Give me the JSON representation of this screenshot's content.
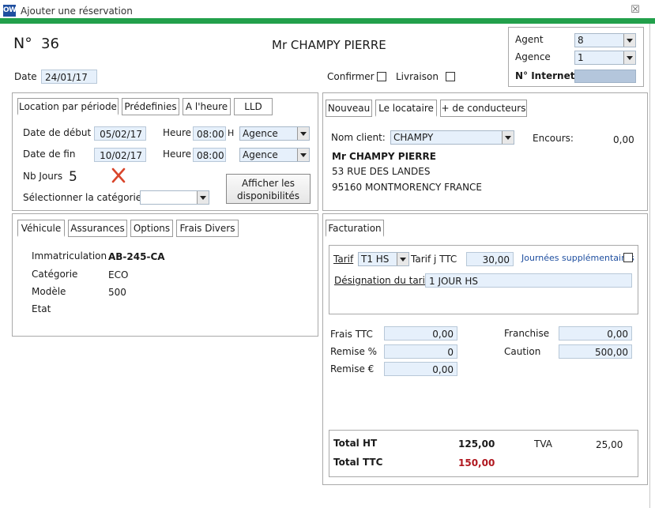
{
  "window": {
    "icon_text": "OW",
    "title": "Ajouter une réservation",
    "close_symbol": "☒"
  },
  "header": {
    "no_label": "N°",
    "no_value": "36",
    "client_title": "Mr CHAMPY PIERRE",
    "date_label": "Date",
    "date_value": "24/01/17",
    "confirmer_label": "Confirmer",
    "livraison_label": "Livraison",
    "agent_label": "Agent",
    "agent_value": "8",
    "agence_label": "Agence",
    "agence_value": "1",
    "internet_label": "N° Internet",
    "internet_value": ""
  },
  "rental": {
    "tabs": [
      "Location par période",
      "Prédefinies",
      "A l'heure",
      "LLD"
    ],
    "start_label": "Date de début",
    "start_date": "05/02/17",
    "heure_label": "Heure",
    "start_time": "08:00",
    "h_suffix": "H",
    "start_place": "Agence",
    "end_label": "Date de fin",
    "end_date": "10/02/17",
    "end_time": "08:00",
    "end_place": "Agence",
    "days_label": "Nb Jours",
    "days_value": "5",
    "category_label": "Sélectionner la catégorie",
    "category_value": "",
    "dispo_button_line1": "Afficher les",
    "dispo_button_line2": "disponibilités"
  },
  "renter": {
    "tabs": [
      "Nouveau",
      "Le locataire",
      "+ de conducteurs"
    ],
    "client_label": "Nom client:",
    "client_value": "CHAMPY",
    "encours_label": "Encours:",
    "encours_value": "0,00",
    "name": "Mr CHAMPY PIERRE",
    "address1": "53 RUE DES LANDES",
    "address2": "95160 MONTMORENCY FRANCE"
  },
  "vehicle": {
    "tabs": [
      "Véhicule",
      "Assurances",
      "Options",
      "Frais Divers"
    ],
    "immat_label": "Immatriculation",
    "immat_value": "AB-245-CA",
    "cat_label": "Catégorie",
    "cat_value": "ECO",
    "model_label": "Modèle",
    "model_value": "500",
    "etat_label": "Etat",
    "etat_value": ""
  },
  "billing": {
    "tab": "Facturation",
    "tarif_label": "Tarif",
    "tarif_value": "T1 HS",
    "tarif_ttc_label": "Tarif j TTC",
    "tarif_ttc_value": "30,00",
    "extra_days_label": "Journées supplémentaires",
    "designation_label": "Désignation du tarif",
    "designation_value": "1 JOUR HS",
    "frais_label": "Frais TTC",
    "frais_value": "0,00",
    "remise_pct_label": "Remise %",
    "remise_pct_value": "0",
    "remise_eur_label": "Remise  €",
    "remise_eur_value": "0,00",
    "franchise_label": "Franchise",
    "franchise_value": "0,00",
    "caution_label": "Caution",
    "caution_value": "500,00",
    "total_ht_label": "Total HT",
    "total_ht_value": "125,00",
    "tva_label": "TVA",
    "tva_value": "25,00",
    "total_ttc_label": "Total TTC",
    "total_ttc_value": "150,00"
  },
  "colors": {
    "accent_green": "#22a04b",
    "field_blue": "#e6f0fb",
    "total_red": "#b0171f",
    "link_blue": "#1f4fa0"
  }
}
